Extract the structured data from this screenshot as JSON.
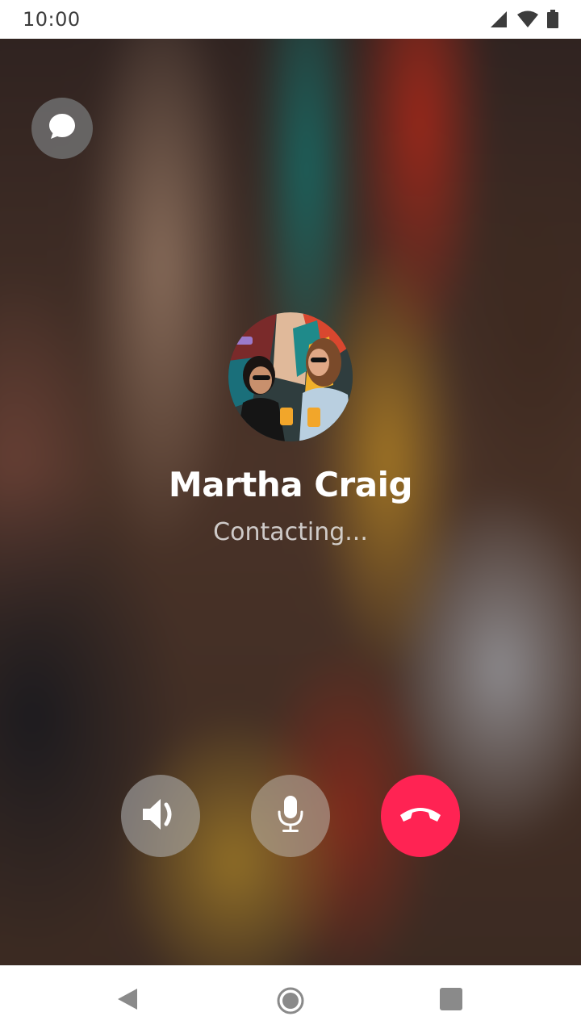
{
  "status_bar": {
    "time": "10:00",
    "icons": [
      "cellular-signal-icon",
      "wifi-icon",
      "battery-icon"
    ]
  },
  "call": {
    "caller_name": "Martha Craig",
    "status": "Contacting...",
    "avatar": "contact-photo"
  },
  "actions": {
    "chat": "chat-bubble-icon",
    "speaker": "speaker-icon",
    "mute": "microphone-icon",
    "end_call": "end-call-icon"
  },
  "colors": {
    "end_call": "#ff2353",
    "button_translucent": "#aaaaaa",
    "text_primary": "#ffffff"
  },
  "nav_bar": {
    "back": "back-triangle-icon",
    "home": "home-circle-icon",
    "recents": "recents-square-icon"
  }
}
